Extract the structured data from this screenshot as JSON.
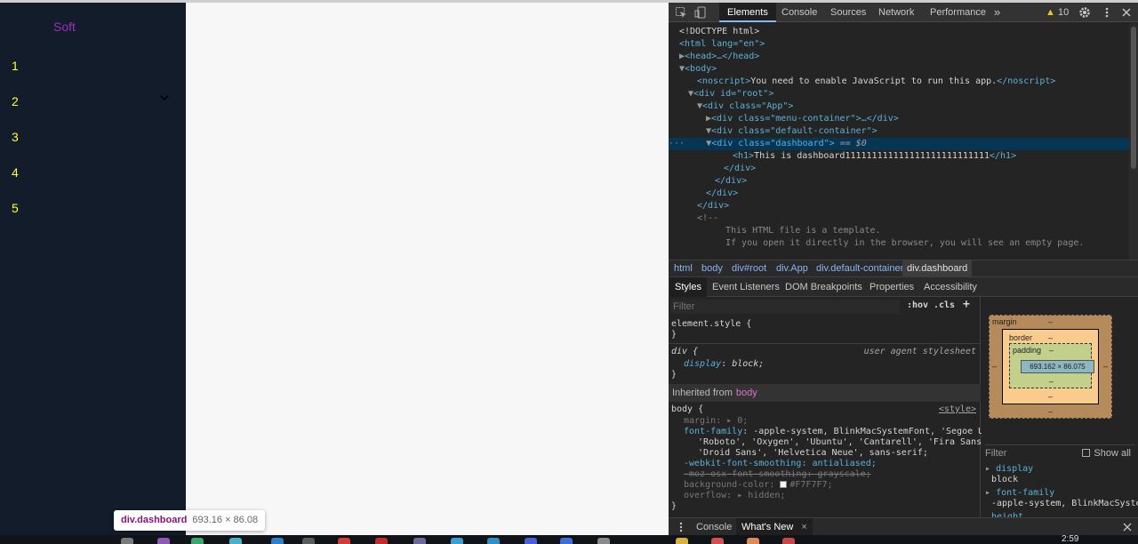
{
  "app": {
    "brand": "Soft",
    "menu": [
      {
        "label": "1"
      },
      {
        "label": "2",
        "has_submenu": true
      },
      {
        "label": "3"
      },
      {
        "label": "4"
      },
      {
        "label": "5"
      }
    ]
  },
  "tooltip": {
    "selector": "div.dashboard",
    "dimensions": "693.16 × 86.08"
  },
  "devtools": {
    "tabs": [
      "Elements",
      "Console",
      "Sources",
      "Network",
      "Performance"
    ],
    "active_tab": "Elements",
    "more_tabs": "»",
    "warning_count": "10",
    "tree": {
      "doctype": "<!DOCTYPE html>",
      "html_open": "<html lang=\"en\">",
      "head": "<head>…</head>",
      "body_open": "<body>",
      "noscript_text": "You need to enable JavaScript to run this app.",
      "root": "<div id=\"root\">",
      "app": "<div class=\"App\">",
      "menu_container": "<div class=\"menu-container\">…</div>",
      "default_container": "<div class=\"default-container\">",
      "dashboard": "<div class=\"dashboard\">",
      "dashboard_marker": "== $0",
      "h1_text": "This is dashboard111111111111111111111111111",
      "div_close": "</div>",
      "comment_open": "<!--",
      "comment_line1": "This HTML file is a template.",
      "comment_line2": "If you open it directly in the browser, you will see an empty page."
    },
    "breadcrumbs": [
      "html",
      "body",
      "div#root",
      "div.App",
      "div.default-container",
      "div.dashboard"
    ],
    "subtabs": [
      "Styles",
      "Event Listeners",
      "DOM Breakpoints",
      "Properties",
      "Accessibility"
    ],
    "styles": {
      "filter_placeholder": "Filter",
      "hov": ":hov",
      "cls": ".cls",
      "plus": "+",
      "element_style": "element.style {",
      "close_brace": "}",
      "div_selector": "div {",
      "div_source": "user agent stylesheet",
      "display_prop": "display",
      "display_val": "block;",
      "inherited_label": "Inherited from",
      "inherited_from": "body",
      "body_selector": "body {",
      "body_source": "<style>",
      "margin_prop": "margin",
      "margin_val": "0;",
      "font_family_prop": "font-family",
      "font_family_val1": "-apple-system, BlinkMacSystemFont, 'Segoe UI',",
      "font_family_val2": "'Roboto', 'Oxygen', 'Ubuntu', 'Cantarell', 'Fira Sans',",
      "font_family_val3": "'Droid Sans', 'Helvetica Neue', sans-serif;",
      "webkit_smoothing": "-webkit-font-smoothing: antialiased;",
      "moz_smoothing": "-moz-osx-font-smoothing: grayscale;",
      "bg_prop": "background-color",
      "bg_val": "#F7F7F7;",
      "bg_swatch": "#F7F7F7",
      "overflow_prop": "overflow",
      "overflow_val": "hidden;"
    },
    "box_model": {
      "margin_label": "margin",
      "border_label": "border",
      "padding_label": "padding",
      "dash": "–",
      "content_size": "693.162 × 86.075"
    },
    "computed": {
      "filter_placeholder": "Filter",
      "show_all": "Show all",
      "display_prop": "display",
      "display_val": "block",
      "font_family_prop": "font-family",
      "font_family_val": "-apple-system, BlinkMacSystemFont",
      "height_prop": "height"
    },
    "drawer": {
      "tabs": [
        "Console",
        "What's New"
      ],
      "active_tab": "What's New",
      "close": "×"
    }
  },
  "taskbar": {
    "clock": "2:59"
  },
  "colors": {
    "sidebar_bg": "#131c2b",
    "menu_text": "#ffff33",
    "brand_text": "#9b2fbf",
    "main_bg": "#f7f7f7",
    "devtools_bg": "#242424",
    "selection_bg": "#073655"
  }
}
